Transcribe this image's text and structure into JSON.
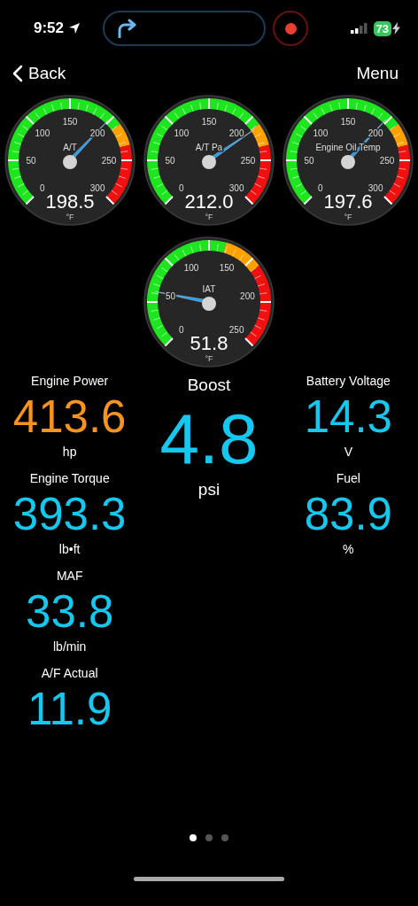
{
  "status_bar": {
    "time": "9:52",
    "battery": "73"
  },
  "nav": {
    "back": "Back",
    "menu": "Menu"
  },
  "gauges": [
    {
      "label": "A/T",
      "reading": "198.5",
      "unit": "°F",
      "ticks": [
        "0",
        "50",
        "100",
        "150",
        "200",
        "250",
        "300"
      ]
    },
    {
      "label": "A/T Pa",
      "reading": "212.0",
      "unit": "°F",
      "ticks": [
        "0",
        "50",
        "100",
        "150",
        "200",
        "250",
        "300"
      ]
    },
    {
      "label": "Engine Oil Temp",
      "reading": "197.6",
      "unit": "°F",
      "ticks": [
        "0",
        "50",
        "100",
        "150",
        "200",
        "250",
        "300"
      ]
    },
    {
      "label": "IAT",
      "reading": "51.8",
      "unit": "°F",
      "ticks": [
        "0",
        "50",
        "100",
        "150",
        "200",
        "250"
      ]
    }
  ],
  "columns": [
    [
      {
        "label": "Engine Power",
        "value": "413.6",
        "unit": "hp",
        "color": "#f7941d"
      },
      {
        "label": "Engine Torque",
        "value": "393.3",
        "unit": "lb•ft",
        "color": "#14c8f0"
      },
      {
        "label": "MAF",
        "value": "33.8",
        "unit": "lb/min",
        "color": "#14c8f0"
      },
      {
        "label": "A/F Actual",
        "value": "11.9",
        "color": "#14c8f0"
      }
    ],
    [
      {
        "label": "Boost",
        "value": "4.8",
        "unit": "psi",
        "color": "#14c8f0",
        "kind": "large"
      }
    ],
    [
      {
        "label": "Battery Voltage",
        "value": "14.3",
        "unit": "V",
        "color": "#14c8f0"
      },
      {
        "label": "Fuel",
        "value": "83.9",
        "unit": "%",
        "color": "#14c8f0"
      }
    ]
  ],
  "pages": [
    {
      "selected": true
    },
    {
      "selected": false
    },
    {
      "selected": false
    }
  ]
}
